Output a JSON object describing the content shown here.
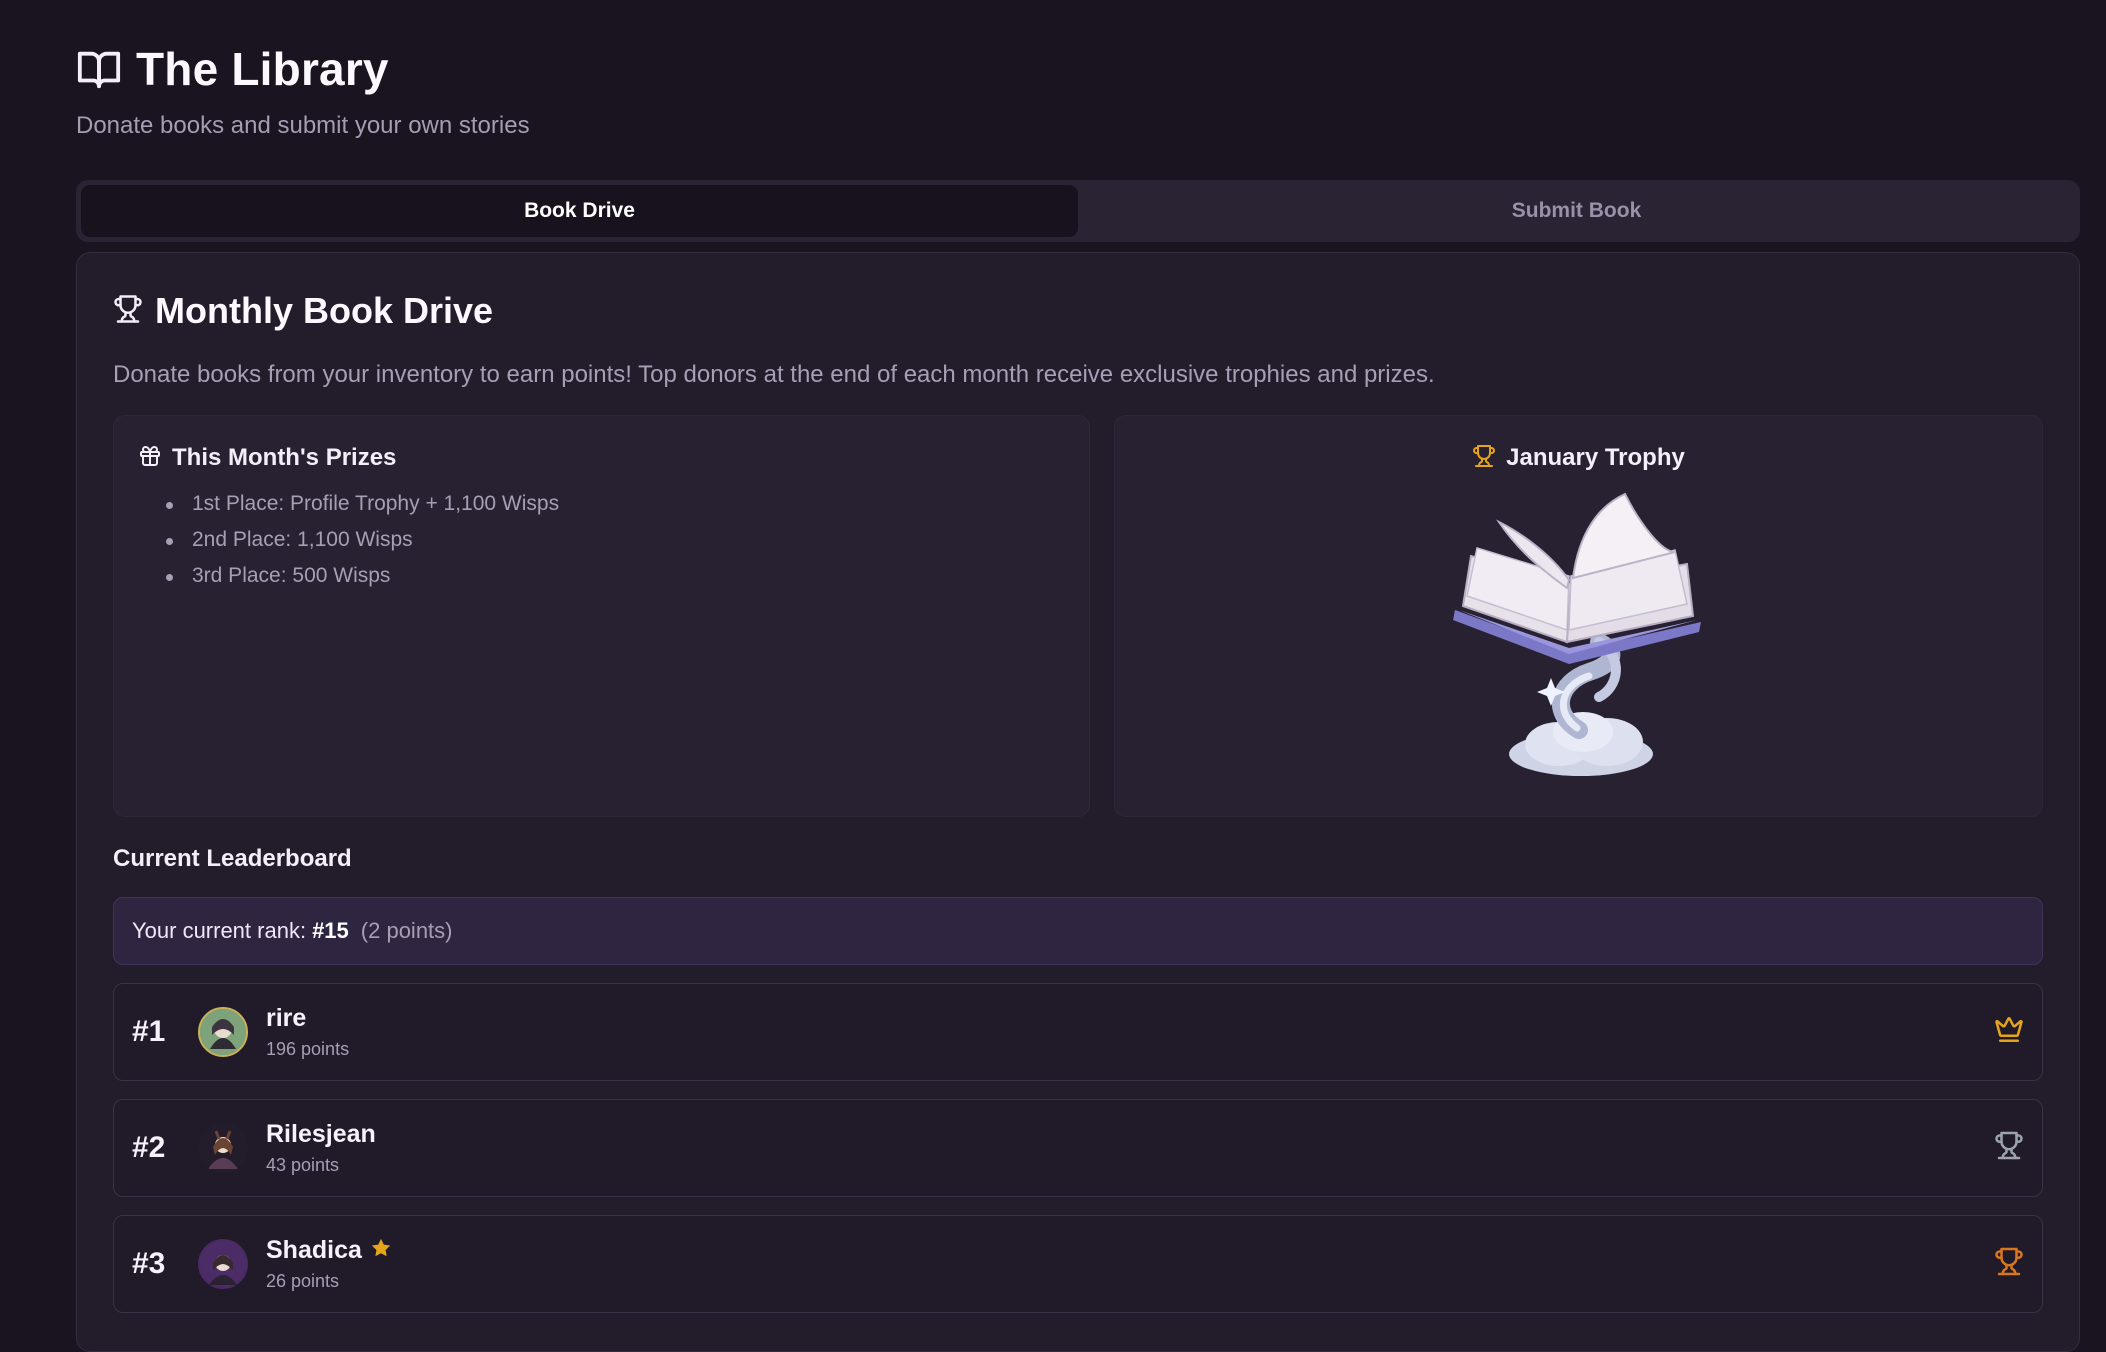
{
  "header": {
    "title": "The Library",
    "subtitle": "Donate books and submit your own stories",
    "icon": "book-open-icon"
  },
  "tabs": [
    {
      "label": "Book Drive",
      "active": true
    },
    {
      "label": "Submit Book",
      "active": false
    }
  ],
  "book_drive": {
    "title": "Monthly Book Drive",
    "title_icon": "trophy-icon",
    "description": "Donate books from your inventory to earn points! Top donors at the end of each month receive exclusive trophies and prizes.",
    "prizes": {
      "title": "This Month's Prizes",
      "icon": "gift-icon",
      "items": [
        "1st Place: Profile Trophy + 1,100 Wisps",
        "2nd Place: 1,100 Wisps",
        "3rd Place: 500 Wisps"
      ]
    },
    "trophy": {
      "title": "January Trophy",
      "icon": "trophy-icon",
      "image": "open-book-on-cloud-trophy"
    }
  },
  "leaderboard": {
    "title": "Current Leaderboard",
    "current_rank": {
      "prefix": "Your current rank:",
      "rank": "#15",
      "points": "(2 points)"
    },
    "rows": [
      {
        "rank": "#1",
        "name": "rire",
        "points": "196 points",
        "badge_icon": "crown-icon",
        "badge_color": "#e5a51a",
        "starred": false
      },
      {
        "rank": "#2",
        "name": "Rilesjean",
        "points": "43 points",
        "badge_icon": "trophy-icon",
        "badge_color": "#9ca3af",
        "starred": false
      },
      {
        "rank": "#3",
        "name": "Shadica",
        "points": "26 points",
        "badge_icon": "trophy-icon",
        "badge_color": "#d9771e",
        "starred": true
      }
    ]
  },
  "colors": {
    "background": "#19141f",
    "card": "#221c2b",
    "gold": "#e5a51a",
    "silver": "#9ca3af",
    "bronze": "#d9771e",
    "accent_banner": "#2f2540"
  }
}
